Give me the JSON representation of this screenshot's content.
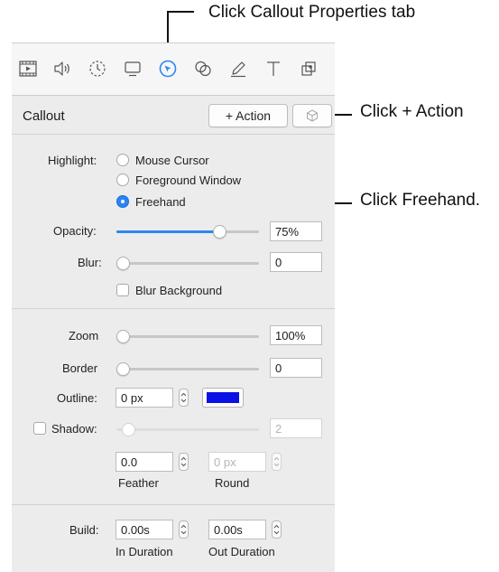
{
  "annotations": {
    "tab": "Click Callout Properties tab",
    "action": "Click  + Action",
    "freehand": "Click Freehand."
  },
  "toolbar": {
    "icons": [
      "video-icon",
      "audio-icon",
      "transition-icon",
      "screen-icon",
      "callout-cursor-icon",
      "filter-icon",
      "annotation-pen-icon",
      "text-icon",
      "interactivity-icon"
    ],
    "active": "callout-cursor-icon"
  },
  "header": {
    "title": "Callout",
    "action_label": "+ Action"
  },
  "highlight": {
    "label": "Highlight:",
    "options": [
      "Mouse Cursor",
      "Foreground Window",
      "Freehand"
    ],
    "selected": "Freehand"
  },
  "opacity": {
    "label": "Opacity:",
    "value": "75%",
    "level": 0.75
  },
  "blur": {
    "label": "Blur:",
    "value": "0",
    "level": 0
  },
  "blur_background": {
    "label": "Blur Background",
    "checked": false
  },
  "zoom": {
    "label": "Zoom",
    "value": "100%",
    "level": 0
  },
  "border": {
    "label": "Border",
    "value": "0",
    "level": 0
  },
  "outline": {
    "label": "Outline:",
    "value": "0 px",
    "color": "#0a12e6"
  },
  "shadow": {
    "label": "Shadow:",
    "value": "2",
    "checked": false,
    "level": 0
  },
  "feather": {
    "label": "Feather",
    "value": "0.0"
  },
  "round": {
    "label": "Round",
    "value": "0 px"
  },
  "build": {
    "label": "Build:",
    "in_value": "0.00s",
    "in_label": "In Duration",
    "out_value": "0.00s",
    "out_label": "Out Duration"
  },
  "colors": {
    "accent": "#2e86f5"
  }
}
